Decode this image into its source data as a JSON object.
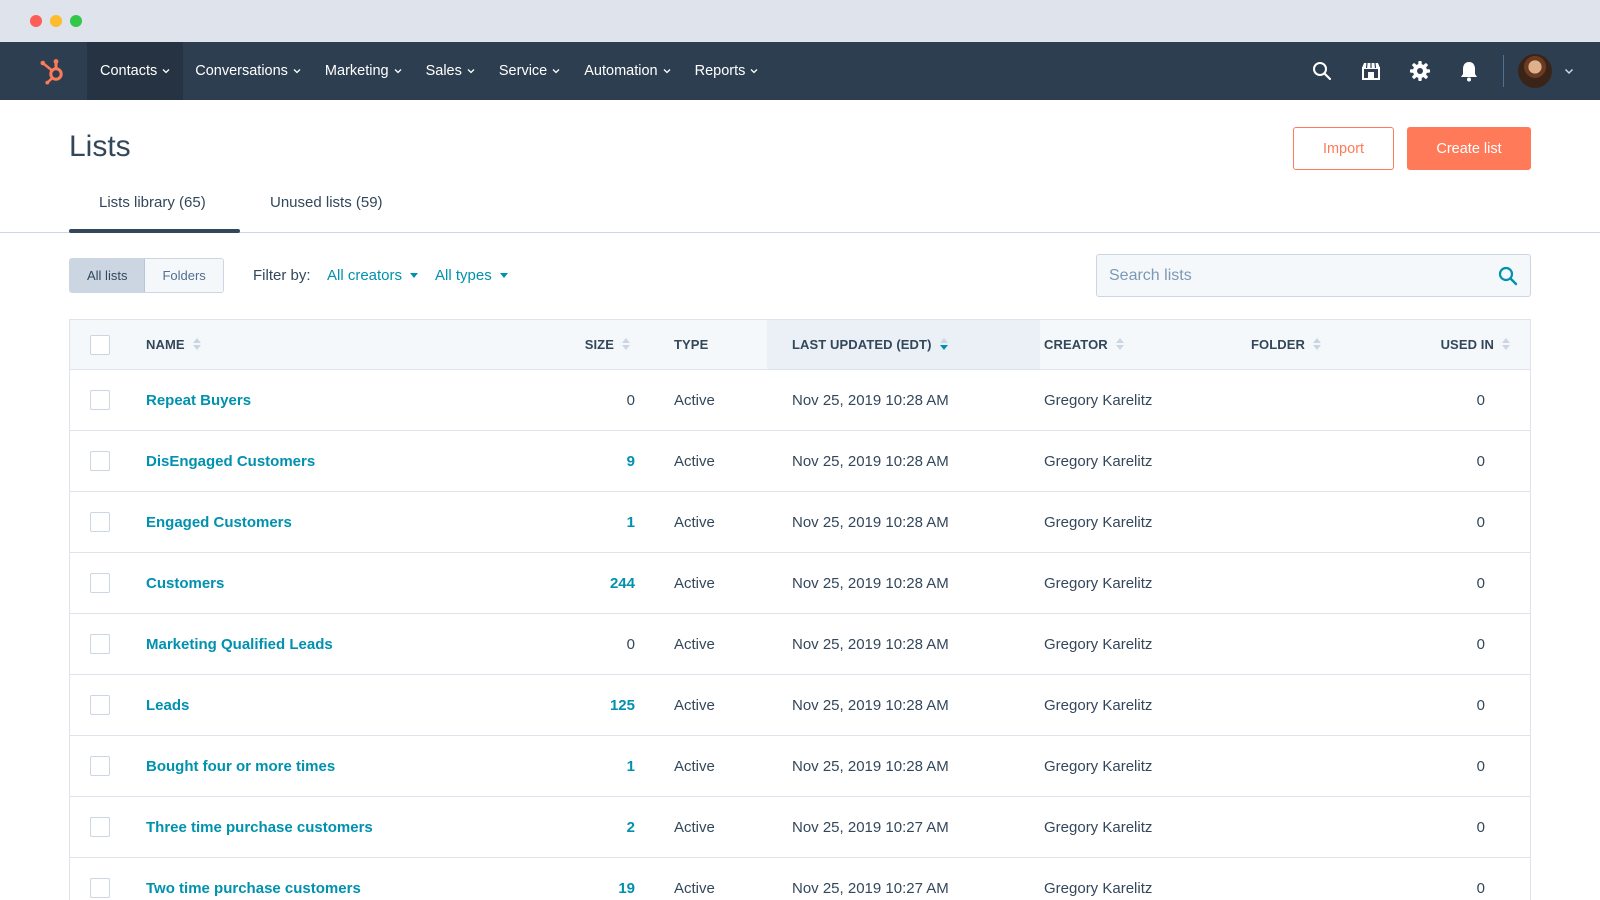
{
  "nav": {
    "items": [
      {
        "label": "Contacts",
        "active": true
      },
      {
        "label": "Conversations"
      },
      {
        "label": "Marketing"
      },
      {
        "label": "Sales"
      },
      {
        "label": "Service"
      },
      {
        "label": "Automation"
      },
      {
        "label": "Reports"
      }
    ],
    "icons": [
      "search-icon",
      "marketplace-icon",
      "settings-gear-icon",
      "notifications-bell-icon"
    ]
  },
  "page": {
    "title": "Lists",
    "import_label": "Import",
    "create_label": "Create list"
  },
  "tabs": [
    {
      "label": "Lists library (65)",
      "active": true
    },
    {
      "label": "Unused lists (59)"
    }
  ],
  "filters": {
    "seg_all": "All lists",
    "seg_folders": "Folders",
    "label": "Filter by:",
    "creators": "All creators",
    "types": "All types",
    "search_placeholder": "Search lists"
  },
  "table": {
    "headers": {
      "name": "NAME",
      "size": "SIZE",
      "type": "TYPE",
      "updated": "LAST UPDATED (EDT)",
      "creator": "CREATOR",
      "folder": "FOLDER",
      "used": "USED IN"
    },
    "rows": [
      {
        "name": "Repeat Buyers",
        "size": "0",
        "size_link": false,
        "type": "Active",
        "updated": "Nov 25, 2019 10:28 AM",
        "creator": "Gregory Karelitz",
        "folder": "",
        "used": "0"
      },
      {
        "name": "DisEngaged Customers",
        "size": "9",
        "size_link": true,
        "type": "Active",
        "updated": "Nov 25, 2019 10:28 AM",
        "creator": "Gregory Karelitz",
        "folder": "",
        "used": "0"
      },
      {
        "name": "Engaged Customers",
        "size": "1",
        "size_link": true,
        "type": "Active",
        "updated": "Nov 25, 2019 10:28 AM",
        "creator": "Gregory Karelitz",
        "folder": "",
        "used": "0"
      },
      {
        "name": "Customers",
        "size": "244",
        "size_link": true,
        "type": "Active",
        "updated": "Nov 25, 2019 10:28 AM",
        "creator": "Gregory Karelitz",
        "folder": "",
        "used": "0"
      },
      {
        "name": "Marketing Qualified Leads",
        "size": "0",
        "size_link": false,
        "type": "Active",
        "updated": "Nov 25, 2019 10:28 AM",
        "creator": "Gregory Karelitz",
        "folder": "",
        "used": "0"
      },
      {
        "name": "Leads",
        "size": "125",
        "size_link": true,
        "type": "Active",
        "updated": "Nov 25, 2019 10:28 AM",
        "creator": "Gregory Karelitz",
        "folder": "",
        "used": "0"
      },
      {
        "name": "Bought four or more times",
        "size": "1",
        "size_link": true,
        "type": "Active",
        "updated": "Nov 25, 2019 10:28 AM",
        "creator": "Gregory Karelitz",
        "folder": "",
        "used": "0"
      },
      {
        "name": "Three time purchase customers",
        "size": "2",
        "size_link": true,
        "type": "Active",
        "updated": "Nov 25, 2019 10:27 AM",
        "creator": "Gregory Karelitz",
        "folder": "",
        "used": "0"
      },
      {
        "name": "Two time purchase customers",
        "size": "19",
        "size_link": true,
        "type": "Active",
        "updated": "Nov 25, 2019 10:27 AM",
        "creator": "Gregory Karelitz",
        "folder": "",
        "used": "0"
      }
    ]
  },
  "colors": {
    "nav_bg": "#2d3e50",
    "accent": "#ff7a59",
    "link": "#0091ae",
    "text": "#33475b"
  }
}
